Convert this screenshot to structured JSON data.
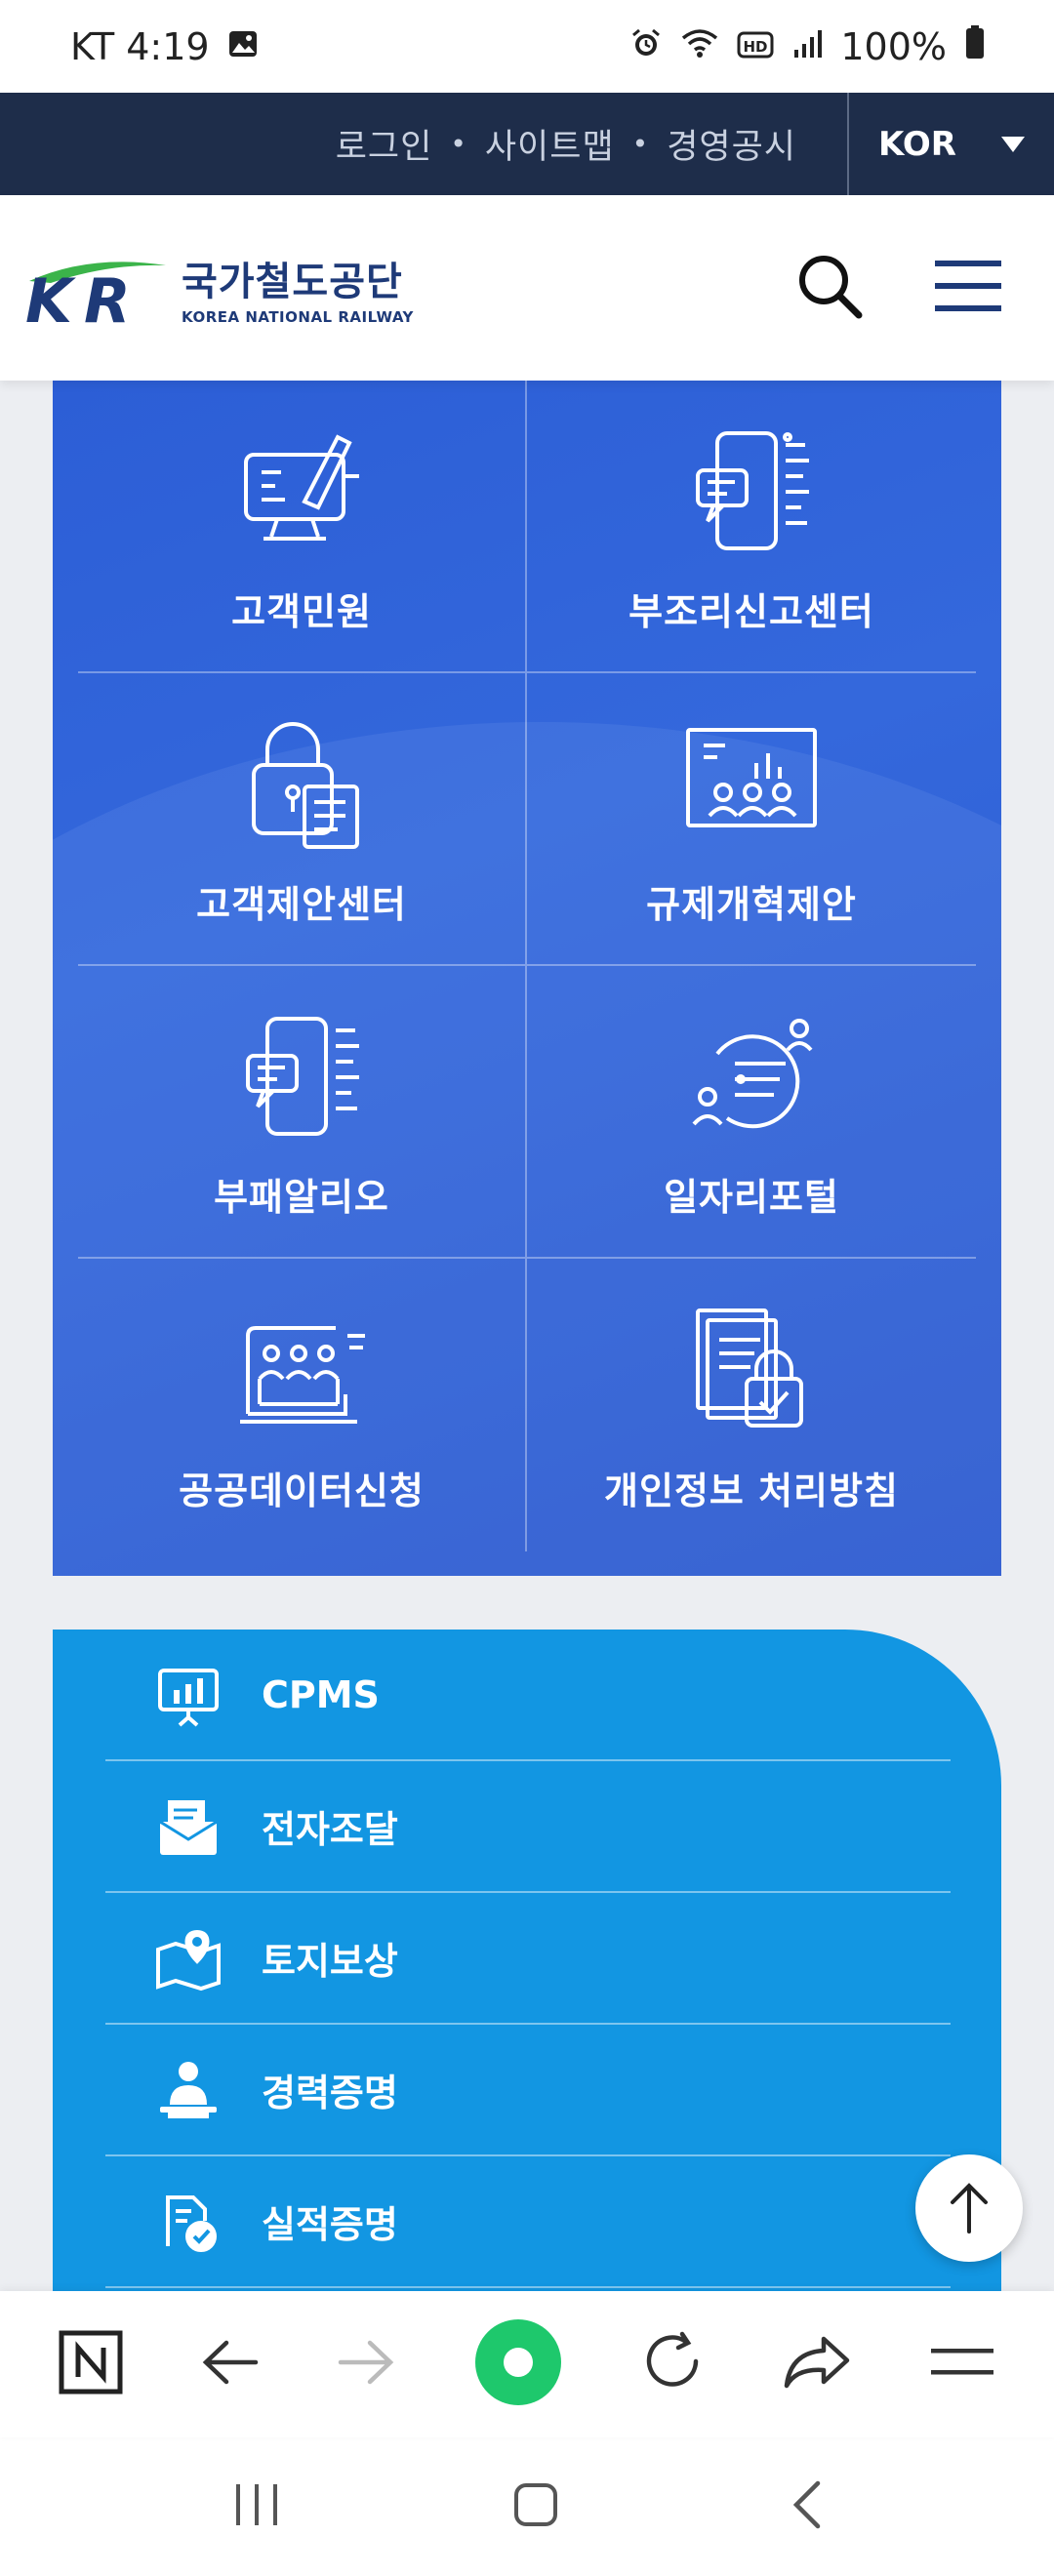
{
  "status_bar": {
    "carrier_time": "KT 4:19",
    "battery": "100%",
    "icons": [
      "gallery-icon",
      "alarm-icon",
      "wifi-icon",
      "hd-icon",
      "signal-icon",
      "battery-icon"
    ]
  },
  "util_bar": {
    "links": [
      "로그인",
      "사이트맵",
      "경영공시"
    ],
    "language": "KOR"
  },
  "header": {
    "logo_ko": "국가철도공단",
    "logo_en": "KOREA NATIONAL RAILWAY"
  },
  "services": [
    {
      "label": "고객민원",
      "icon": "complaint-monitor-icon"
    },
    {
      "label": "부조리신고센터",
      "icon": "report-document-icon"
    },
    {
      "label": "고객제안센터",
      "icon": "locked-proposal-icon"
    },
    {
      "label": "규제개혁제안",
      "icon": "presentation-board-icon"
    },
    {
      "label": "부패알리오",
      "icon": "corruption-report-icon"
    },
    {
      "label": "일자리포털",
      "icon": "job-portal-icon"
    },
    {
      "label": "공공데이터신청",
      "icon": "public-data-icon"
    },
    {
      "label": "개인정보 처리방침",
      "icon": "privacy-policy-icon"
    }
  ],
  "quick_links": [
    {
      "label": "CPMS",
      "icon": "presentation-chart-icon"
    },
    {
      "label": "전자조달",
      "icon": "procurement-icon"
    },
    {
      "label": "토지보상",
      "icon": "map-pin-icon"
    },
    {
      "label": "경력증명",
      "icon": "person-desk-icon"
    },
    {
      "label": "실적증명",
      "icon": "certified-document-icon"
    }
  ],
  "colors": {
    "util_bar": "#1e2d4a",
    "grid_blue": "#2f62d8",
    "list_blue": "#1296e2",
    "brand_navy": "#1e3a78",
    "brand_green": "#3bb44a"
  }
}
